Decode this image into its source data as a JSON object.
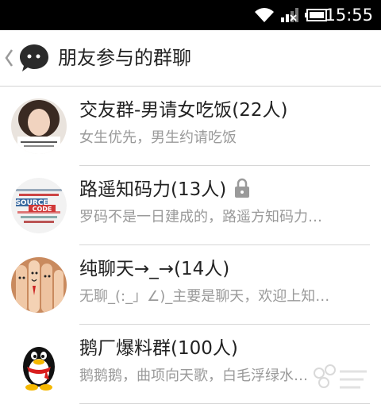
{
  "status_bar": {
    "time": "15:55",
    "icons": [
      "wifi-icon",
      "signal-icon",
      "battery-icon"
    ]
  },
  "header": {
    "title": "朋友参与的群聊",
    "back_icon": "chevron-left-icon",
    "logo_icon": "chat-bubble-logo"
  },
  "groups": [
    {
      "name": "交友群-男请女吃饭(22人)",
      "preview": "女生优先，男生约请吃饭",
      "avatar": "photo-girl",
      "locked": false
    },
    {
      "name": "路遥知码力(13人)",
      "preview": "罗码不是一日建成的，路遥方知码力…",
      "avatar": "source-code-word-cloud",
      "locked": true
    },
    {
      "name": "纯聊天→_→(14人)",
      "preview": "无聊_(:_」∠)_主要是聊天，欢迎上知…",
      "avatar": "finger-faces",
      "locked": false
    },
    {
      "name": "鹅厂爆料群(100人)",
      "preview": "鹅鹅鹅，曲项向天歌，白毛浮绿水…",
      "avatar": "qq-penguin",
      "locked": false
    }
  ],
  "colors": {
    "status_bar_bg": "#000000",
    "divider": "#d6d6d6",
    "name_text": "#222222",
    "preview_text": "#9a9a9a"
  }
}
